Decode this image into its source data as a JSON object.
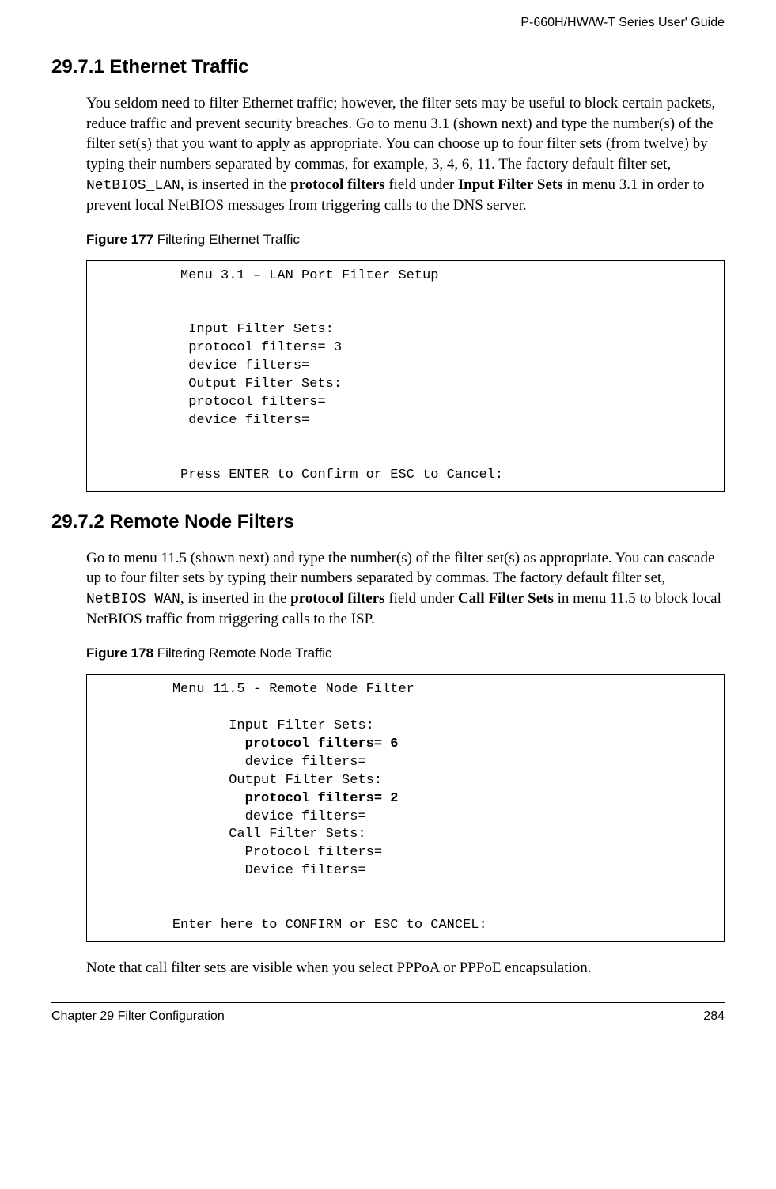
{
  "header": {
    "guideTitle": "P-660H/HW/W-T Series User' Guide"
  },
  "section1": {
    "heading": "29.7.1  Ethernet Traffic",
    "paragraph_pre": "You seldom need to filter Ethernet traffic; however, the filter sets may be useful to block certain packets, reduce traffic and prevent security breaches. Go to menu 3.1 (shown next) and type the number(s) of the filter set(s) that you want to apply as appropriate. You can choose up to four filter sets (from twelve) by typing their numbers separated by commas, for example, 3, 4, 6, 11. The factory default filter set, ",
    "netbios_lan": "NetBIOS_LAN",
    "paragraph_mid1": ", is inserted in the ",
    "bold_protocol_filters": "protocol filters",
    "paragraph_mid2": " field under ",
    "bold_input_filter_sets": "Input Filter Sets",
    "paragraph_post": " in menu 3.1 in order to prevent local NetBIOS messages from triggering calls to the DNS server."
  },
  "figure177": {
    "label": "Figure 177",
    "caption": "   Filtering Ethernet Traffic",
    "lines": {
      "title": "          Menu 3.1 – LAN Port Filter Setup",
      "blank1": "",
      "blank2": "",
      "l1": "           Input Filter Sets:",
      "l2": "           protocol filters= 3",
      "l3": "           device filters=",
      "l4": "           Output Filter Sets:",
      "l5": "           protocol filters=",
      "l6": "           device filters=",
      "blank3": "",
      "blank4": "",
      "footer": "          Press ENTER to Confirm or ESC to Cancel:"
    }
  },
  "section2": {
    "heading": "29.7.2  Remote Node Filters",
    "paragraph_pre": "Go to menu 11.5 (shown next) and type the number(s) of the filter set(s) as appropriate. You can cascade up to four filter sets by typing their numbers separated by commas. The factory default filter set, ",
    "netbios_wan": "NetBIOS_WAN",
    "paragraph_mid1": ", is inserted in the ",
    "bold_protocol_filters": "protocol filters",
    "paragraph_mid2": " field under ",
    "bold_call_filter_sets": "Call Filter Sets",
    "paragraph_post": " in menu 11.5 to block local NetBIOS traffic from triggering calls to the ISP."
  },
  "figure178": {
    "label": "Figure 178",
    "caption": "   Filtering Remote Node Traffic",
    "lines": {
      "title": "         Menu 11.5 - Remote Node Filter",
      "blank1": "",
      "l1": "                Input Filter Sets:",
      "b1pre": "                  ",
      "b1": "protocol filters= 6",
      "l2": "                  device filters=",
      "l3": "                Output Filter Sets:",
      "b2pre": "                  ",
      "b2": "protocol filters= 2",
      "l4": "                  device filters=",
      "l5": "                Call Filter Sets:",
      "l6": "                  Protocol filters=",
      "l7": "                  Device filters=",
      "blank2": "",
      "blank3": "",
      "footer": "         Enter here to CONFIRM or ESC to CANCEL:"
    }
  },
  "note": "Note that call filter sets are visible when you select PPPoA or PPPoE encapsulation.",
  "footer": {
    "chapter": "Chapter 29 Filter Configuration",
    "page": "284"
  }
}
